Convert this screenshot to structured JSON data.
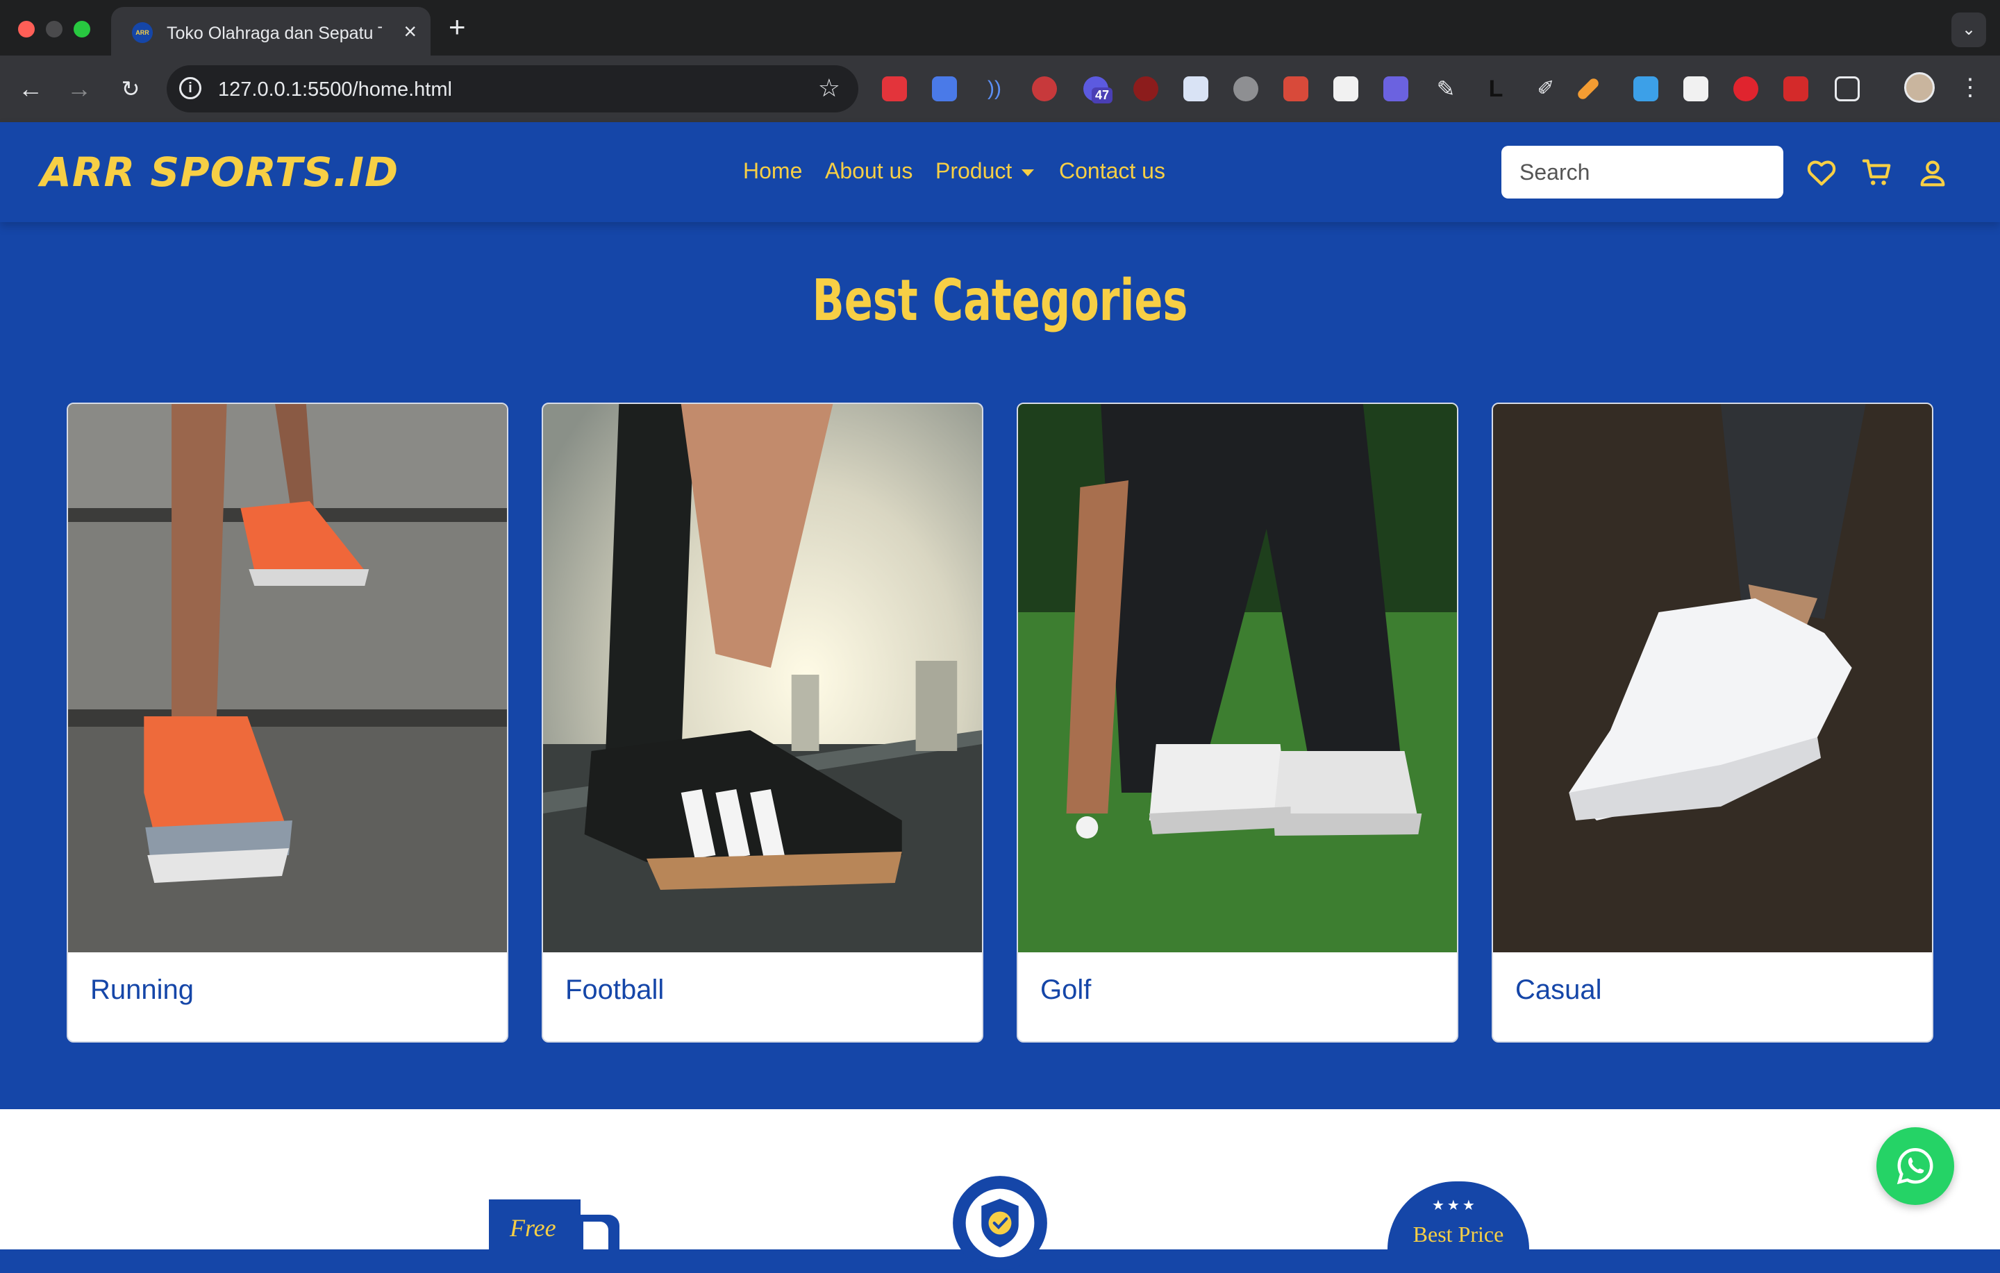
{
  "browser": {
    "tab_title": "Toko Olahraga dan Sepatu Terbaik",
    "tab_favicon_text": "ARR",
    "url": "127.0.0.1:5500/home.html",
    "extension_badge": "47"
  },
  "header": {
    "logo": "ARR SPORTS.ID",
    "nav": {
      "home": "Home",
      "about": "About us",
      "product": "Product",
      "contact": "Contact us"
    },
    "search_placeholder": "Search",
    "icons": [
      "heart-icon",
      "cart-icon",
      "user-icon"
    ]
  },
  "categories": {
    "title": "Best Categories",
    "items": [
      {
        "label": "Running"
      },
      {
        "label": "Football"
      },
      {
        "label": "Golf"
      },
      {
        "label": "Casual"
      }
    ]
  },
  "features": {
    "free_label": "Free",
    "best_price_label": "Best Price"
  },
  "colors": {
    "brand_blue": "#1546a8",
    "brand_yellow": "#f7cf45",
    "whatsapp_green": "#25d366"
  }
}
